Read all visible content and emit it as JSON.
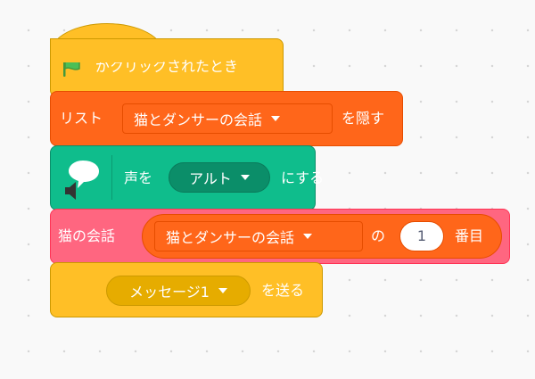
{
  "event_block": {
    "label": "がクリックされたとき",
    "flag_icon": "green-flag-icon",
    "color": "#ffbf26"
  },
  "list_block": {
    "prefix": "リスト",
    "list_name": "猫とダンサーの会話",
    "suffix": "を隠す",
    "color": "#ff661a"
  },
  "extension_block": {
    "voice_label": "声を",
    "voice_value": "アルト",
    "suffix": "にする",
    "color": "#0fbd8c",
    "icon": "speech-bubble-speaker-icon"
  },
  "custom_block": {
    "label": "猫の会話",
    "reporter": {
      "list_name": "猫とダンサーの会話",
      "of_label": "の",
      "index_value": "1",
      "item_label": "番目"
    },
    "color": "#ff6680"
  },
  "send_block": {
    "message": "メッセージ1",
    "suffix": "を送る",
    "color": "#ffbf26"
  }
}
